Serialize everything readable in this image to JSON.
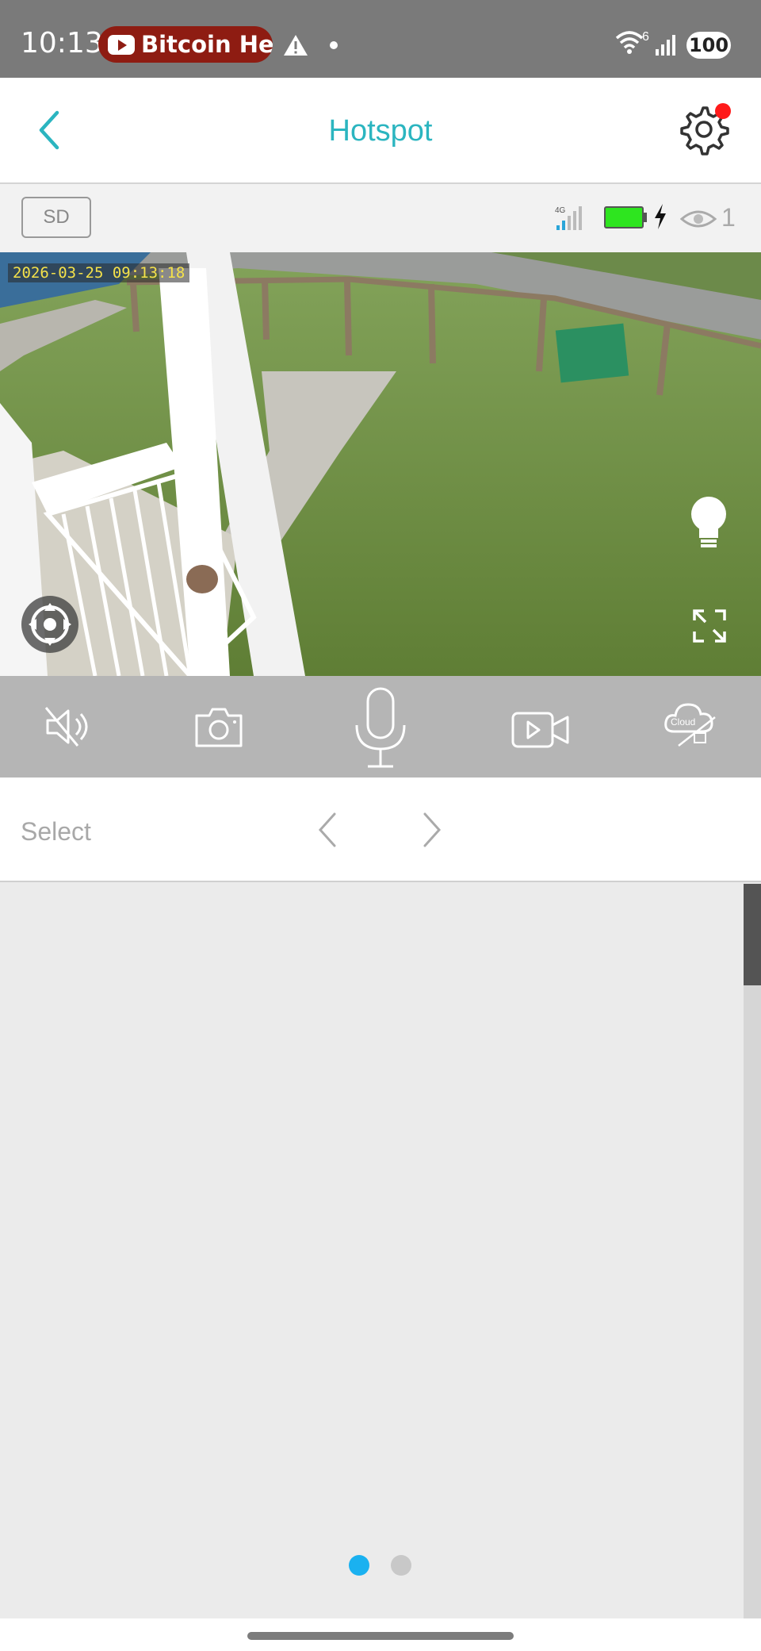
{
  "status_bar": {
    "time": "10:13",
    "notification_text": "Bitcoin Hea",
    "wifi_superscript": "6",
    "battery_level": "100"
  },
  "header": {
    "title": "Hotspot",
    "title_color": "#2bb5c0",
    "settings_has_notification": true
  },
  "info_bar": {
    "storage_label": "SD",
    "network_label": "4G",
    "viewer_count": "1",
    "battery_color": "#2ee51f"
  },
  "video": {
    "timestamp": "2026-03-25 09:13:18"
  },
  "controls": {
    "icons": [
      "speaker-muted-icon",
      "camera-icon",
      "microphone-icon",
      "video-record-icon",
      "cloud-off-icon"
    ],
    "cloud_label": "Cloud"
  },
  "date_bar": {
    "select_label": "Select"
  },
  "pagination": {
    "pages": 2,
    "active_page": 1,
    "active_color": "#1ab1f0"
  }
}
